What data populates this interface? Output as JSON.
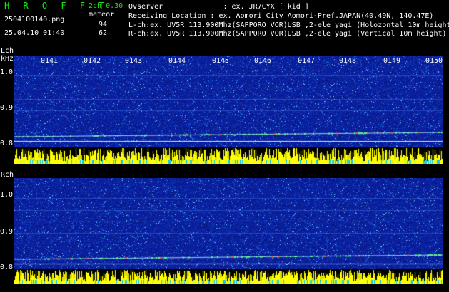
{
  "header": {
    "title": "H R O F F T",
    "version": "2ch 0.30",
    "filename": "2504100140.png",
    "mode": "meteor",
    "datetime": "25.04.10 01:40",
    "lch_count": "94",
    "rch_count": "62"
  },
  "info_lines": [
    "Ovserver              : ex. JR7CYX [ kid ]",
    "Receiving Location : ex. Aomori City Aomori-Pref.JAPAN(40.49N, 140.47E)",
    "L-ch:ex. UV5R 113.900Mhz(SAPPORO VOR)USB ,2-ele yagi (Holozontal 10m height)",
    "R-ch:ex. UV5R 113.900Mhz(SAPPORO VOR)USB ,2-ele yagi (Vertical 10m height)"
  ],
  "time_ticks": [
    "0141",
    "0142",
    "0143",
    "0144",
    "0145",
    "0146",
    "0147",
    "0148",
    "0149",
    "0150"
  ],
  "lch": {
    "label": "Lch",
    "unit": "kHz",
    "y_labels": [
      "1.0",
      "0.9",
      "0.8"
    ]
  },
  "rch": {
    "label": "Rch",
    "y_labels": [
      "1.0",
      "0.9",
      "0.8"
    ]
  },
  "colors": {
    "background": "#000000",
    "spectrogram_base": "#0a1f9e",
    "signal_bar": "#ffff00",
    "cyan_bar": "#00c8ff",
    "title_green": "#19e619"
  }
}
